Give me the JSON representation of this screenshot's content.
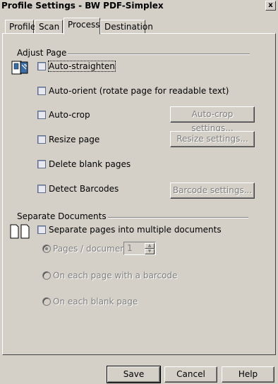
{
  "window": {
    "title": "Profile Settings - BW PDF-Simplex",
    "close_glyph": "x"
  },
  "tabs": [
    {
      "label": "Profile",
      "active": false
    },
    {
      "label": "Scan",
      "active": false
    },
    {
      "label": "Process",
      "active": true
    },
    {
      "label": "Destination",
      "active": false
    }
  ],
  "adjust_page": {
    "group_label": "Adjust Page",
    "icon": "page-adjust-icon",
    "options": [
      {
        "label": "Auto-straighten",
        "checked": false
      },
      {
        "label": "Auto-orient (rotate page for readable text)",
        "checked": false
      },
      {
        "label": "Auto-crop",
        "checked": false
      },
      {
        "label": "Resize page",
        "checked": false
      },
      {
        "label": "Delete blank pages",
        "checked": false
      },
      {
        "label": "Detect Barcodes",
        "checked": false
      }
    ],
    "buttons": {
      "autocrop_settings": "Auto-crop settings...",
      "resize_settings": "Resize settings...",
      "barcode_settings": "Barcode settings..."
    }
  },
  "separate_documents": {
    "group_label": "Separate Documents",
    "icon": "split-documents-icon",
    "checkbox_label": "Separate pages into multiple documents",
    "checked": false,
    "radios": [
      {
        "label": "Pages / document:",
        "selected": true
      },
      {
        "label": "On each page with a barcode",
        "selected": false
      },
      {
        "label": "On each blank page",
        "selected": false
      }
    ],
    "pages_per_document": "1"
  },
  "footer": {
    "save": "Save",
    "cancel": "Cancel",
    "help": "Help"
  },
  "colors": {
    "dialog_bg": "#d4d0c8",
    "disabled_text": "#808080"
  }
}
